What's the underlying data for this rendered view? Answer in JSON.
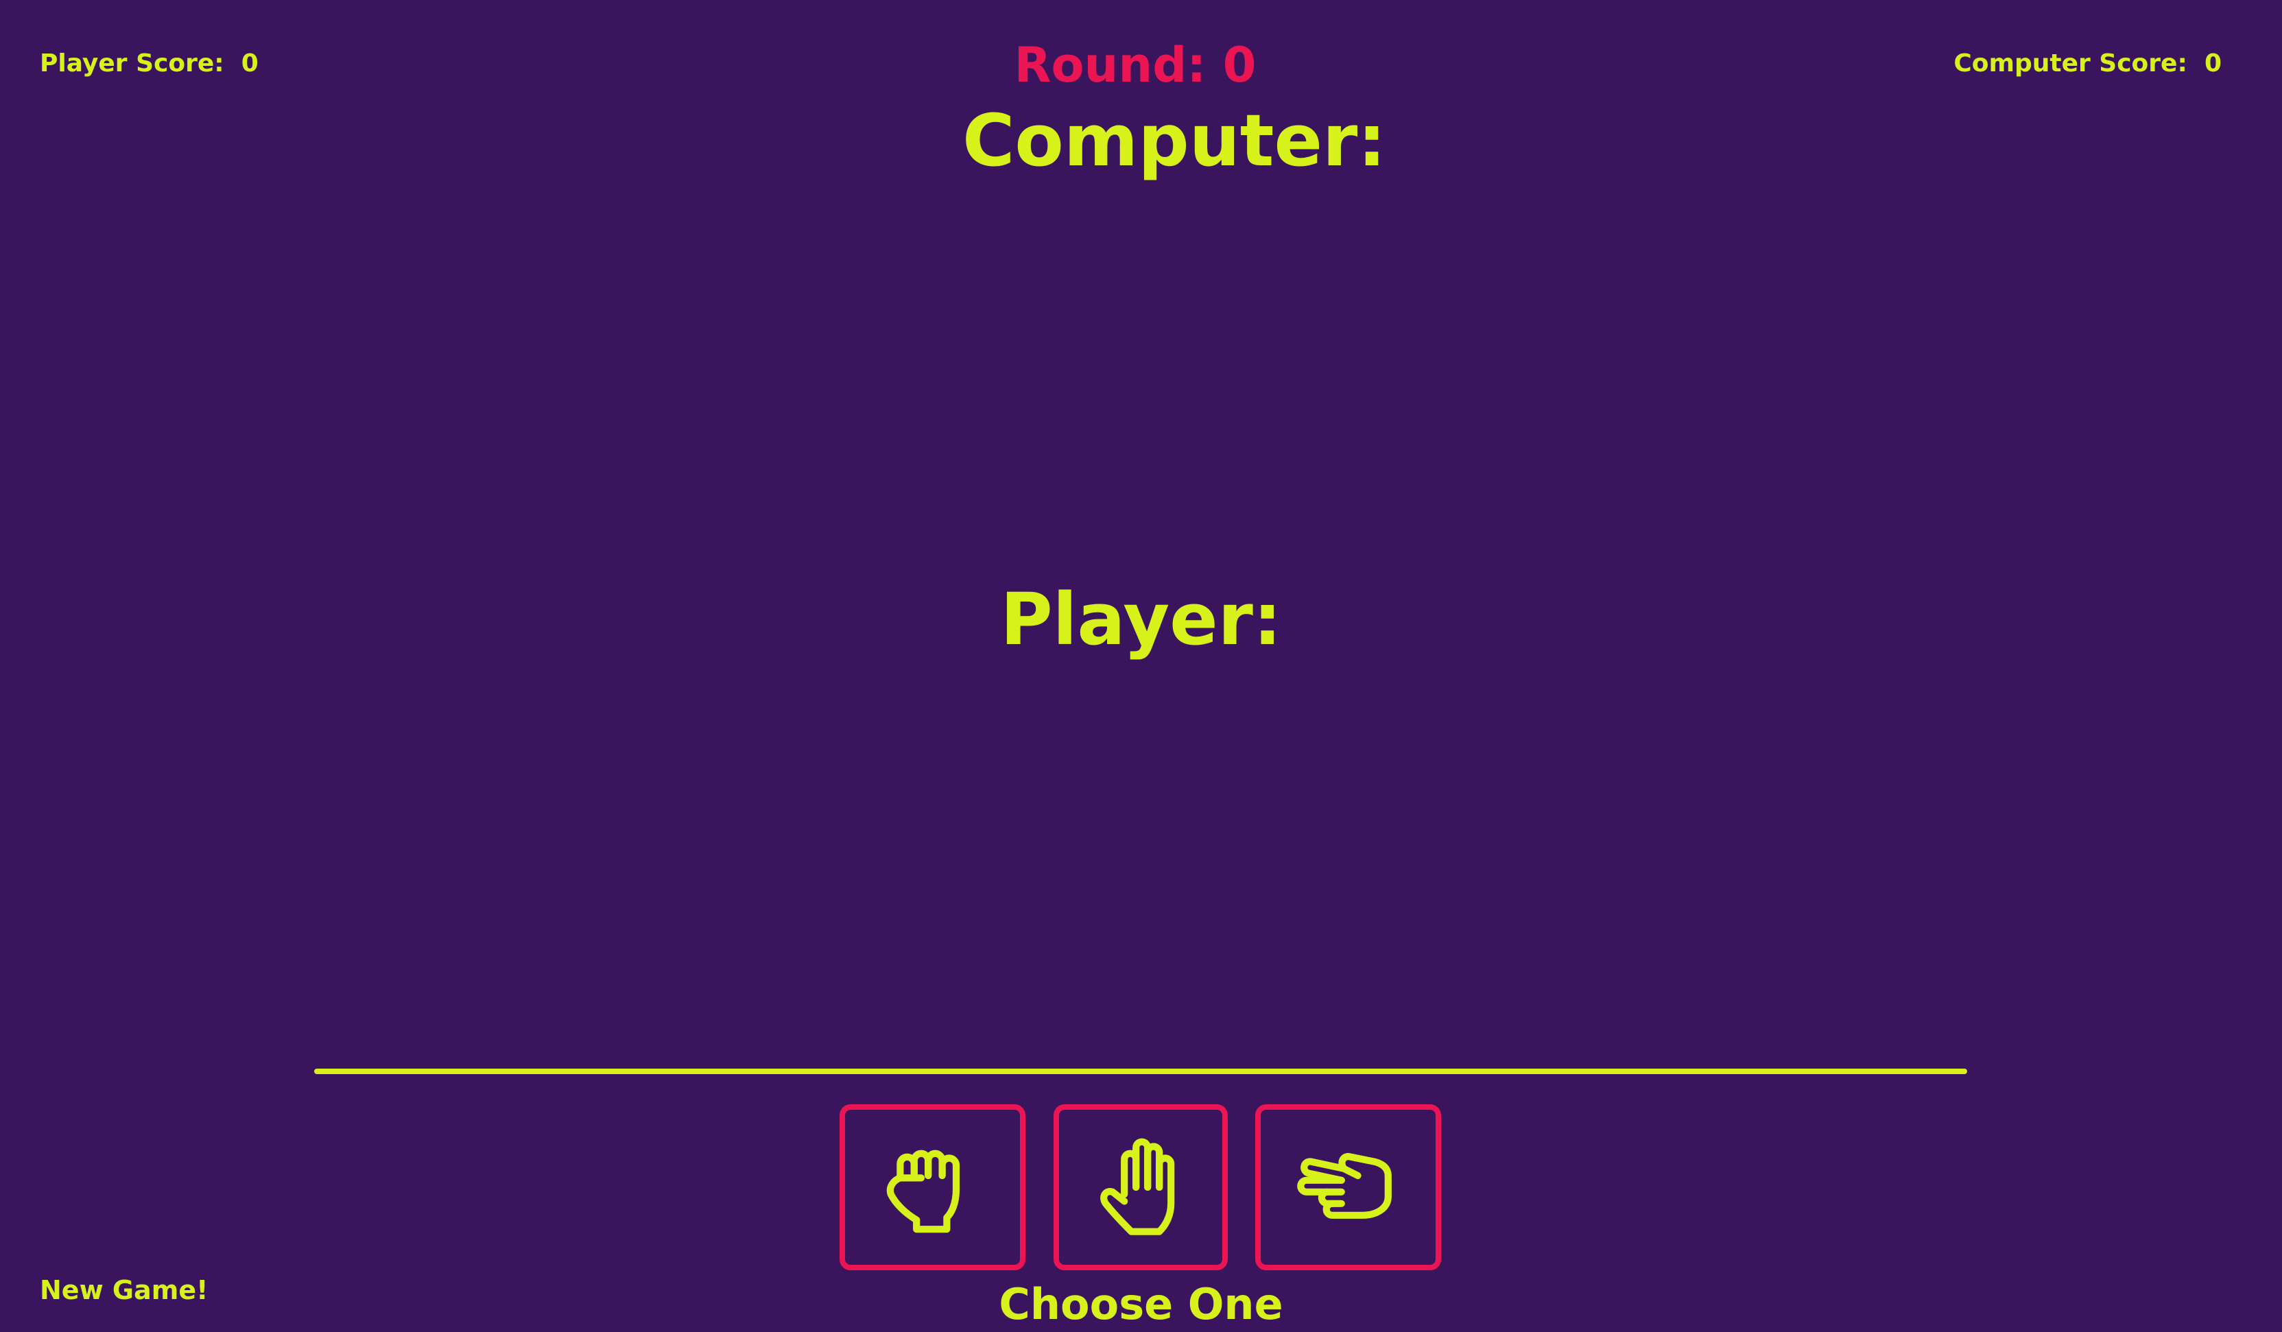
{
  "scoreboard": {
    "player_label": "Player Score:",
    "player_value": "0",
    "computer_label": "Computer Score:",
    "computer_value": "0",
    "round_label": "Round:",
    "round_value": "0"
  },
  "arena": {
    "computer_label": "Computer:",
    "player_label": "Player:"
  },
  "choices": [
    {
      "name": "rock",
      "icon": "hand-fist-icon"
    },
    {
      "name": "paper",
      "icon": "hand-open-icon"
    },
    {
      "name": "scissors",
      "icon": "hand-scissors-icon"
    }
  ],
  "controls": {
    "prompt": "Choose One",
    "new_game_label": "New Game!"
  },
  "colors": {
    "background": "#3a145c",
    "accent": "#d6f21a",
    "highlight": "#ec1553"
  }
}
